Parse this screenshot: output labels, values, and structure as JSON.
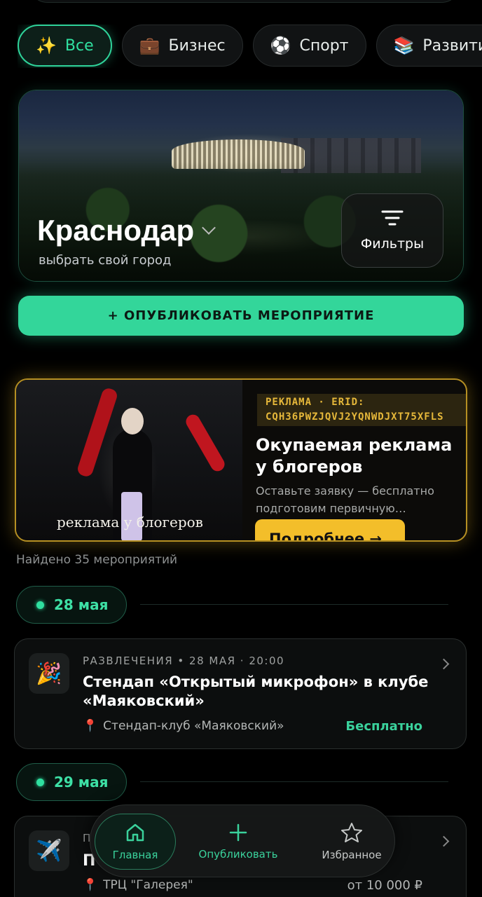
{
  "categories": [
    {
      "emoji": "✨",
      "label": "Все",
      "active": true
    },
    {
      "emoji": "💼",
      "label": "Бизнес"
    },
    {
      "emoji": "⚽",
      "label": "Спорт"
    },
    {
      "emoji": "📚",
      "label": "Развити"
    }
  ],
  "city": {
    "name": "Краснодар",
    "subtitle": "выбрать свой город",
    "filters_label": "Фильтры"
  },
  "publish_button": "+ ОПУБЛИКОВАТЬ МЕРОПРИЯТИЕ",
  "ad": {
    "tag_line1": "РЕКЛАМА · ERID:",
    "tag_line2": "CQH36PWZJQVJ2YQNWDJXT75XFLS",
    "title": "Окупаемая реклама у блогеров",
    "description": "Оставьте заявку — бесплатно подготовим первичную…",
    "button": "Подробнее →",
    "image_caption": "реклама у блогеров"
  },
  "found_text": "Найдено 35 мероприятий",
  "dates": [
    "28 мая",
    "29 мая"
  ],
  "events": [
    {
      "icon": "🎉",
      "meta": "РАЗВЛЕЧЕНИЯ • 28 МАЯ · 20:00",
      "title": "Стендап «Открытый микрофон» в клубе «Маяковский»",
      "place": "Стендап-клуб «Маяковский»",
      "price": "Бесплатно"
    },
    {
      "icon": "✈️",
      "meta": "П",
      "title": "П",
      "place": "ТРЦ \"Галерея\"",
      "price": "от 10 000 ₽"
    }
  ],
  "nav": {
    "home": "Главная",
    "publish": "Опубликовать",
    "favorites": "Избранное"
  },
  "colors": {
    "accent": "#33d69a",
    "ad_border": "#b69023",
    "ad_button": "#f3be2a"
  }
}
